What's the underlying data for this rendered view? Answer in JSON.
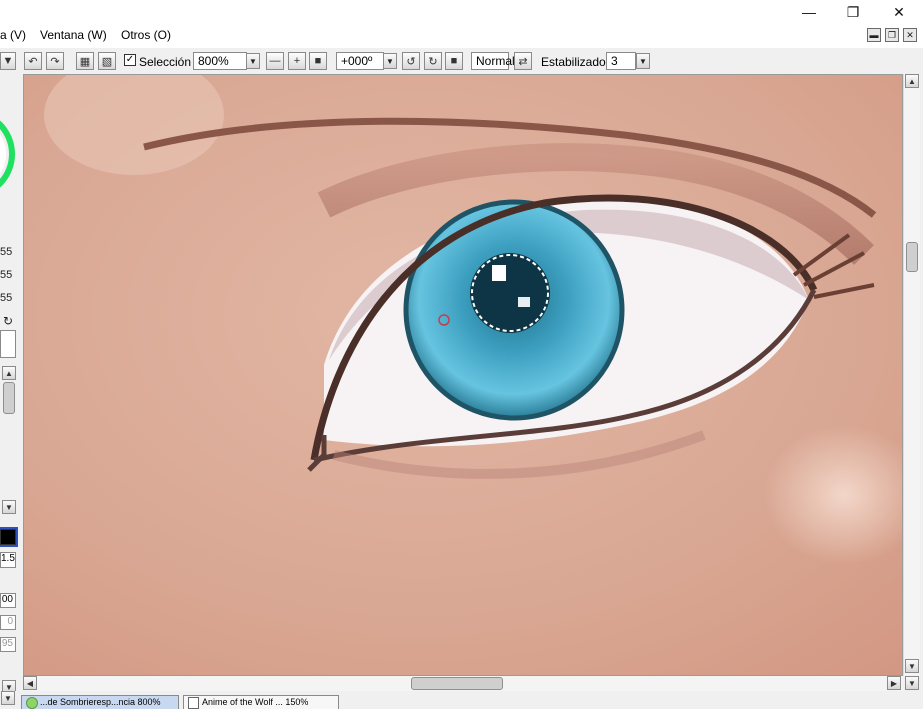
{
  "menu": {
    "items": [
      {
        "label": "a (V)"
      },
      {
        "label": "Ventana (W)"
      },
      {
        "label": "Otros (O)"
      }
    ]
  },
  "toolbar": {
    "selection_label": "Selección",
    "selection_checked": true,
    "zoom_value": "800%",
    "rotation_value": "+000º",
    "blend_mode": "Normal",
    "stabilizer_label": "Estabilizador",
    "stabilizer_value": "3"
  },
  "left_panel": {
    "values": [
      "55",
      "55",
      "55"
    ],
    "size_value": "1.5",
    "density_value": "00",
    "min_size_value": "0",
    "extra_value": "95"
  },
  "tabs": [
    {
      "label": "...de Sombrieresp...ncia 800%",
      "active": true
    },
    {
      "label": "Anime of the Wolf ... 150%",
      "active": false
    }
  ],
  "colors": {
    "iris": "#4aa8c8",
    "skin": "#d9a894",
    "accent_tab": "#c8d8f0"
  }
}
